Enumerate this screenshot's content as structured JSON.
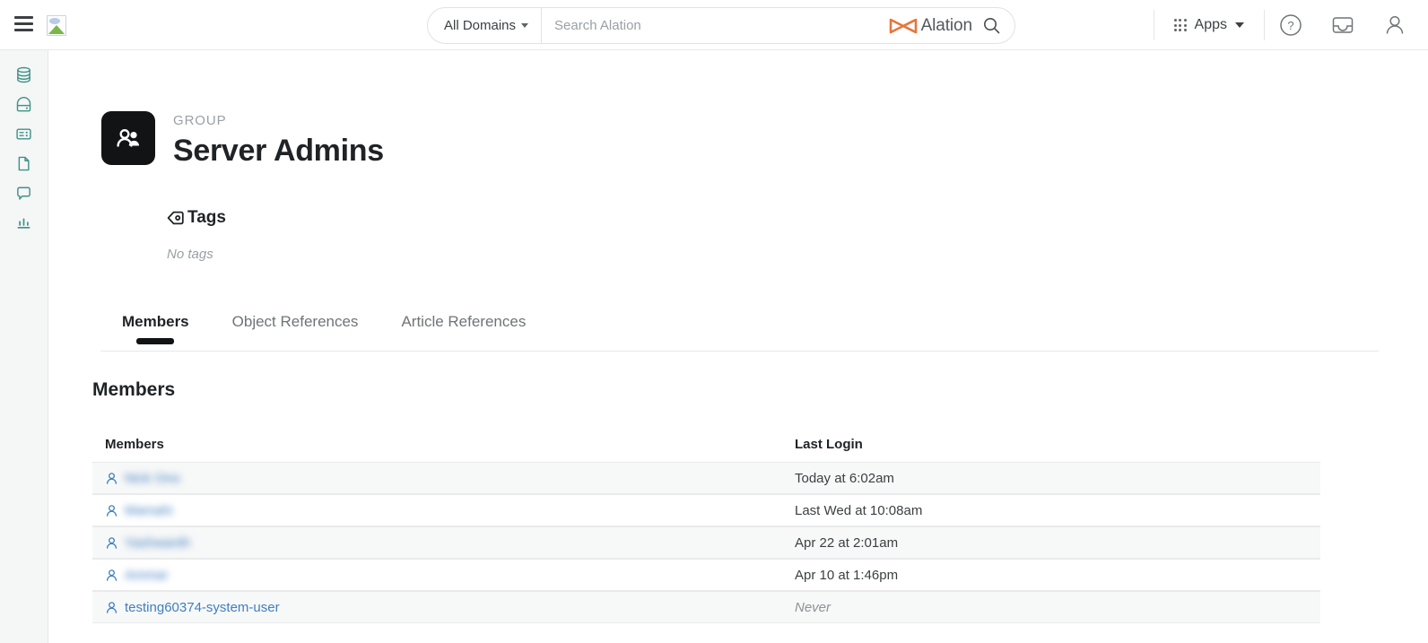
{
  "header": {
    "menu_icon": "hamburger-menu-icon",
    "logo_image": "broken-image-icon",
    "search": {
      "domain_label": "All Domains",
      "placeholder": "Search Alation",
      "value": "",
      "brand_name": "Alation",
      "brand_color": "#E8743B",
      "search_icon": "search-icon"
    },
    "apps_label": "Apps",
    "help_icon": "help-circle-icon",
    "inbox_icon": "inbox-icon",
    "account_icon": "user-account-icon"
  },
  "sidebar": {
    "items": [
      {
        "icon": "database-icon",
        "name": "sources"
      },
      {
        "icon": "safe-lock-icon",
        "name": "policies"
      },
      {
        "icon": "glossary-card-icon",
        "name": "glossary"
      },
      {
        "icon": "document-icon",
        "name": "documents"
      },
      {
        "icon": "conversation-bubble-icon",
        "name": "conversations"
      },
      {
        "icon": "bar-chart-icon",
        "name": "analytics"
      }
    ],
    "accent_color": "#3e9289"
  },
  "page": {
    "eyebrow": "GROUP",
    "title": "Server Admins",
    "avatar_icon": "group-people-icon",
    "tags": {
      "icon": "tag-icon",
      "heading": "Tags",
      "empty_text": "No tags"
    },
    "tabs": [
      {
        "label": "Members",
        "active": true
      },
      {
        "label": "Object References",
        "active": false
      },
      {
        "label": "Article References",
        "active": false
      }
    ],
    "section_title": "Members",
    "table": {
      "columns": [
        "Members",
        "Last Login"
      ],
      "rows": [
        {
          "member": "Nick Ono",
          "redacted": true,
          "last_login": "Today at 6:02am",
          "never": false
        },
        {
          "member": "Mamahi",
          "redacted": true,
          "last_login": "Last Wed at 10:08am",
          "never": false
        },
        {
          "member": "Yashwanth",
          "redacted": true,
          "last_login": "Apr 22 at 2:01am",
          "never": false
        },
        {
          "member": "Ammar",
          "redacted": true,
          "last_login": "Apr 10 at 1:46pm",
          "never": false
        },
        {
          "member": "testing60374-system-user",
          "redacted": false,
          "last_login": "Never",
          "never": true
        }
      ]
    }
  }
}
